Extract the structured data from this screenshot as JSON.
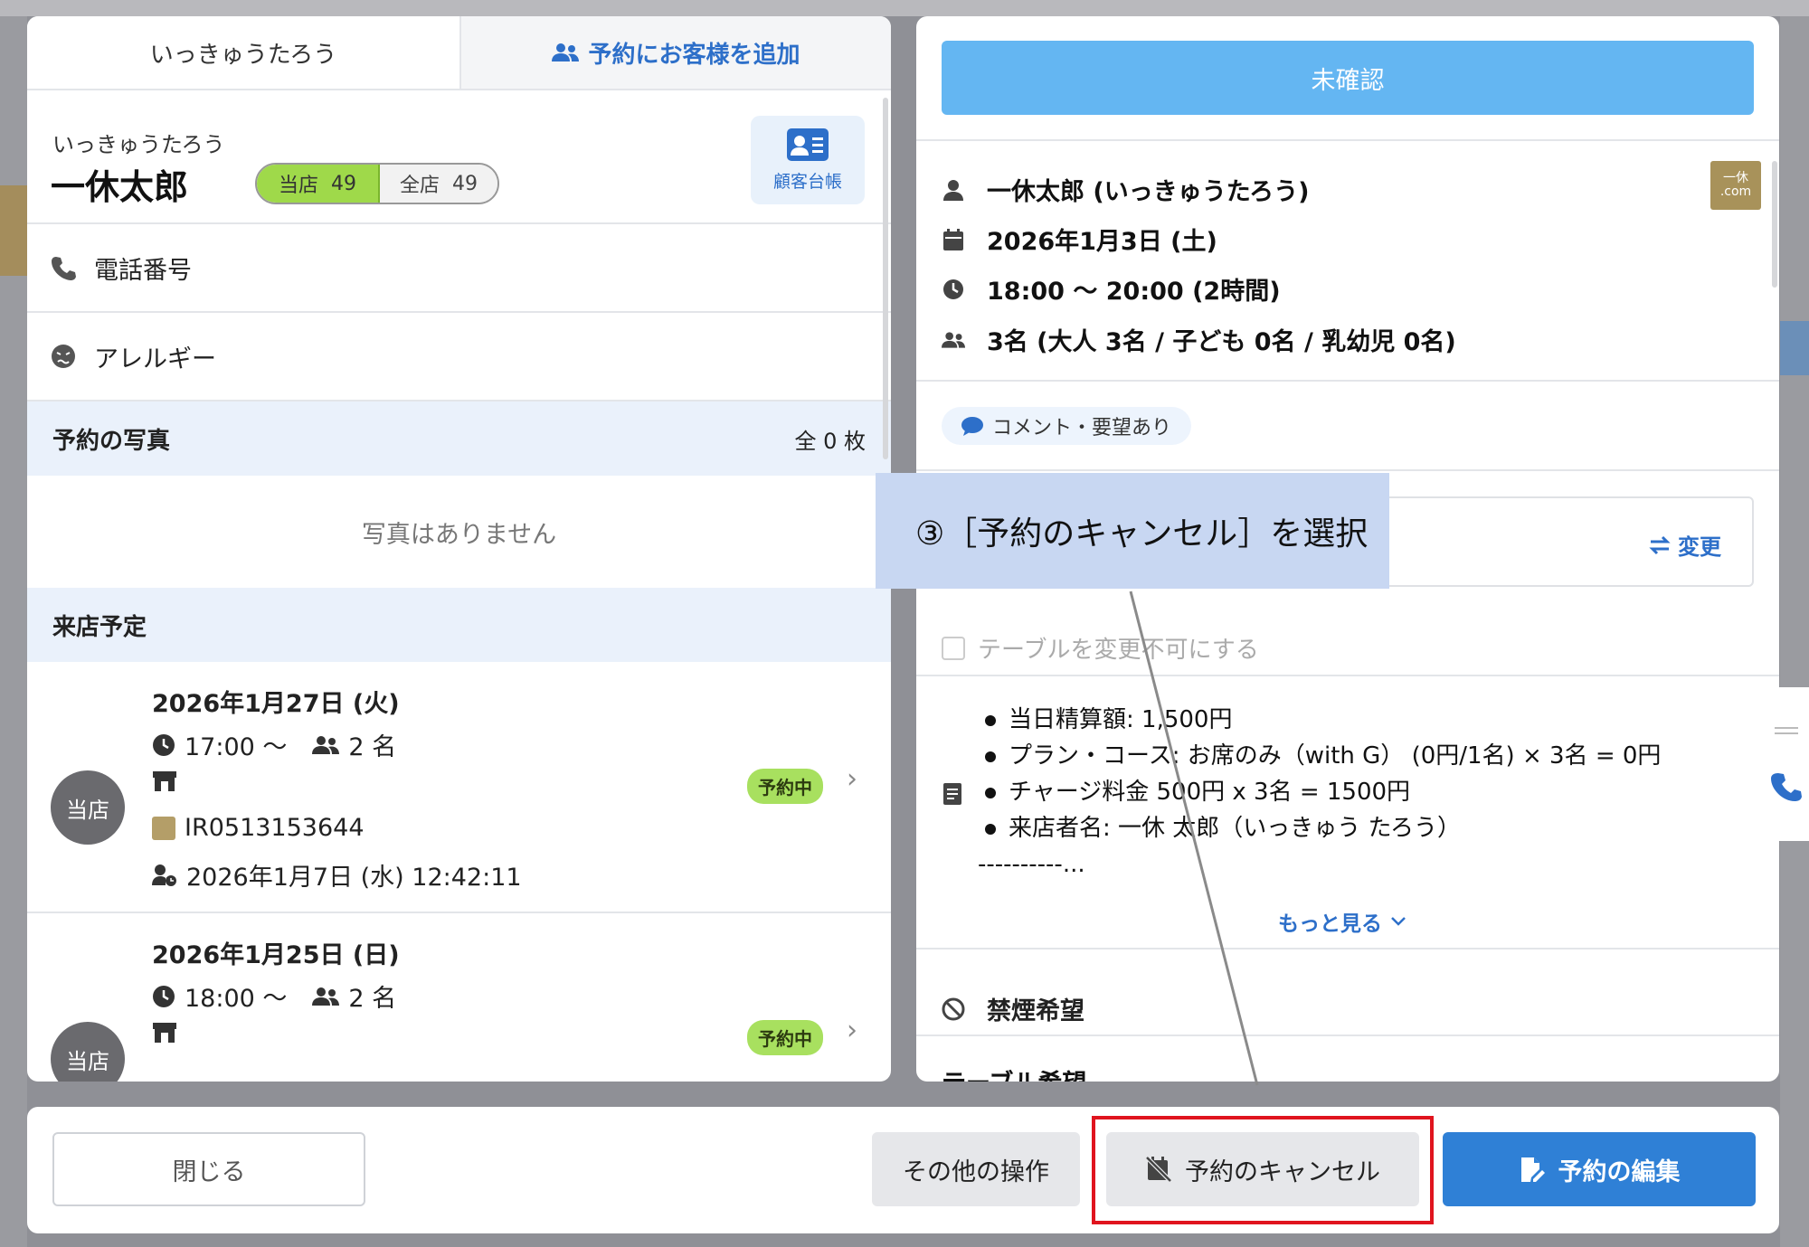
{
  "tabs": {
    "customer_name": "いっきゅうたろう",
    "add_customer": "予約にお客様を追加"
  },
  "customer": {
    "kana": "いっきゅうたろう",
    "name": "一休太郎",
    "store_label": "当店",
    "store_count": "49",
    "all_label": "全店",
    "all_count": "49",
    "ledger_label": "顧客台帳"
  },
  "fields": {
    "phone": "電話番号",
    "allergy": "アレルギー"
  },
  "photos": {
    "title": "予約の写真",
    "count": "全 0 枚",
    "empty": "写真はありません"
  },
  "visits": {
    "title": "来店予定",
    "items": [
      {
        "date": "2026年1月27日 (火)",
        "time": "17:00 〜",
        "people": "2 名",
        "avatar": "当店",
        "status": "予約中",
        "ref": "IR0513153644",
        "created": "2026年1月7日 (水) 12:42:11"
      },
      {
        "date": "2026年1月25日 (日)",
        "time": "18:00 〜",
        "people": "2 名",
        "avatar": "当店",
        "status": "予約中"
      }
    ]
  },
  "reservation": {
    "status": "未確認",
    "guest": "一休太郎 (いっきゅうたろう)",
    "date": "2026年1月3日 (土)",
    "time": "18:00 〜 20:00 (2時間)",
    "party": "3名 (大人 3名 / 子ども 0名 / 乳幼児 0名)",
    "brand_line1": "一休",
    "brand_line2": ".com",
    "comment": "コメント・要望あり",
    "change": "変更",
    "lock_table": "テーブルを変更不可にする",
    "memo": [
      "当日精算額: 1,500円",
      "プラン・コース: お席のみ（with G） (0円/1名) × 3名 = 0円",
      "チャージ料金 500円 x 3名 = 1500円",
      "来店者名: 一休 太郎（いっきゅう たろう）"
    ],
    "memo_more_line": "----------...",
    "more": "もっと見る",
    "smoking": "禁煙希望",
    "table_wish": "テーブル希望"
  },
  "callout": {
    "text": "③［予約のキャンセル］を選択"
  },
  "footer": {
    "close": "閉じる",
    "other": "その他の操作",
    "cancel": "予約のキャンセル",
    "edit": "予約の編集"
  },
  "colors": {
    "accent_blue": "#2f80d6",
    "status_blue": "#64b6f2",
    "green_badge": "#a8e05f",
    "highlight_red": "#e0141e",
    "callout_bg": "#c8d7f2"
  }
}
